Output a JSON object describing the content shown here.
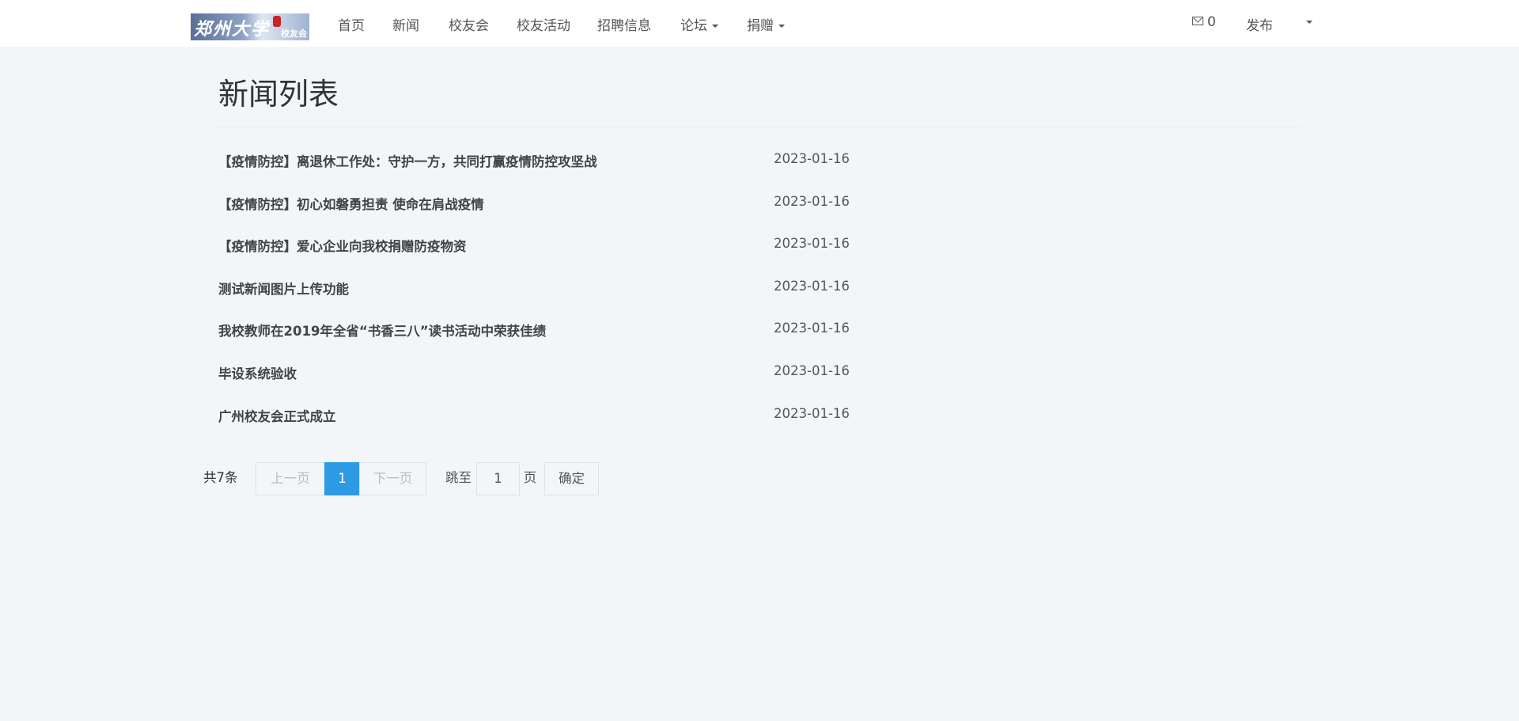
{
  "nav": {
    "logo_text": "郑州大学",
    "logo_sub": "校友会",
    "items": [
      "首页",
      "新闻",
      "校友会",
      "校友活动",
      "招聘信息",
      "论坛",
      "捐赠"
    ],
    "mail_count": "0",
    "publish": "发布"
  },
  "page_title": "新闻列表",
  "news": [
    {
      "title": "【疫情防控】离退休工作处：守护一方，共同打赢疫情防控攻坚战",
      "date": "2023-01-16"
    },
    {
      "title": "【疫情防控】初心如磐勇担责 使命在肩战疫情",
      "date": "2023-01-16"
    },
    {
      "title": "【疫情防控】爱心企业向我校捐赠防疫物资",
      "date": "2023-01-16"
    },
    {
      "title": "测试新闻图片上传功能",
      "date": "2023-01-16"
    },
    {
      "title": "我校教师在2019年全省“书香三八”读书活动中荣获佳绩",
      "date": "2023-01-16"
    },
    {
      "title": "毕设系统验收",
      "date": "2023-01-16"
    },
    {
      "title": "广州校友会正式成立",
      "date": "2023-01-16"
    }
  ],
  "pagination": {
    "total": "共7条",
    "prev": "上一页",
    "current": "1",
    "next": "下一页",
    "jump_label": "跳至",
    "jump_value": "1",
    "page_unit": "页",
    "confirm": "确定"
  }
}
